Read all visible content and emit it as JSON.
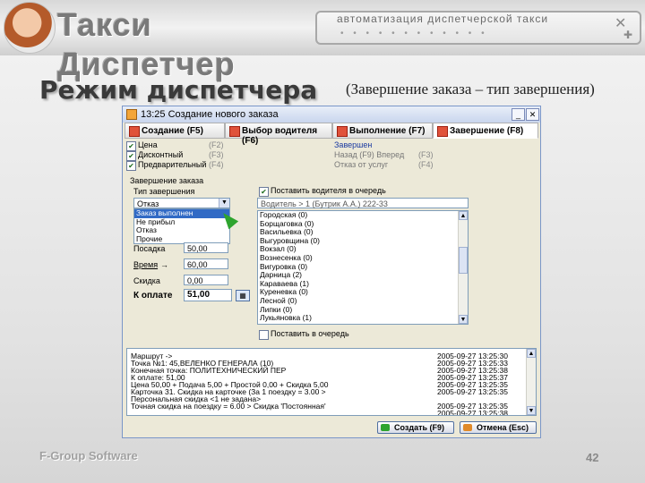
{
  "header": {
    "brand": "Такси Диспетчер",
    "tagline": "автоматизация диспетчерской такси",
    "dots": "• • • • • • • • • • • •"
  },
  "slide": {
    "title": "Режим диспетчера",
    "subtitle": "(Завершение заказа – тип завершения)",
    "footer": "F-Group Software",
    "page": "42"
  },
  "window": {
    "title": "13:25 Создание нового заказа",
    "tabs": [
      "Создание (F5)",
      "Выбор водителя (F6)",
      "Выполнение (F7)",
      "Завершение (F8)"
    ],
    "type_options": [
      {
        "label": "Цена",
        "hot": "(F2)",
        "checked": true
      },
      {
        "label": "Дисконтный",
        "hot": "(F3)",
        "checked": true
      },
      {
        "label": "Предварительный",
        "hot": "(F4)",
        "checked": true
      }
    ],
    "status_items": [
      {
        "label": "Завершен",
        "hot": ""
      },
      {
        "label": "Назад (F9) Вперед",
        "hot": "(F3)"
      },
      {
        "label": "Отказ от услуг",
        "hot": "(F4)"
      }
    ],
    "completion_group": "Завершение заказа",
    "completion_type_label": "Тип завершения",
    "completion_select": "Отказ",
    "dropdown_options": [
      "Заказ выполнен",
      "Не прибыл",
      "Отказ",
      "Прочие"
    ],
    "notify_label": "Поставить водителя в очередь",
    "driver_field": "Водитель > 1 (Бутрик А.А.) 222-33",
    "rows": [
      {
        "label": "Посадка",
        "value": "50,00"
      },
      {
        "label": "Время",
        "value": "60,00"
      },
      {
        "label": "Скидка",
        "value": "0,00"
      }
    ],
    "total_label": "К оплате",
    "total_value": "51,00",
    "districts": [
      "Городская (0)",
      "Борщаговка (0)",
      "Васильевка (0)",
      "Выгуровщина (0)",
      "Вокзал (0)",
      "Вознесенка (0)",
      "Вигуровка (0)",
      "Дарница (2)",
      "Караваева (1)",
      "Куреневка (0)",
      "Лесной (0)",
      "Липки (0)",
      "Лукьяновка (1)",
      "Нивки (0)"
    ],
    "district_more": "...",
    "bottom_check": "Поставить в очередь",
    "log": [
      {
        "text": "Маршрут ->",
        "time": "2005-09-27 13:25:30"
      },
      {
        "text": "Точка №1: 45,ВЕЛЕНКО ГЕНЕРАЛА (10)",
        "time": "2005-09-27 13:25:33"
      },
      {
        "text": "Конечная точка: ПОЛИТЕХНИЧЕСКИЙ ПЕР",
        "time": "2005-09-27 13:25:38"
      },
      {
        "text": "К оплате: 51,00",
        "time": "2005-09-27 13:25:37"
      },
      {
        "text": "Цена 50,00 + Подача 5,00 + Простой 0,00 + Скидка 5,00",
        "time": "2005-09-27 13:25:35"
      },
      {
        "text": "Карточка 31. Скидка на карточке (За 1 поездку = 3.00 >",
        "time": "2005-09-27 13:25:35"
      },
      {
        "text": "Персональная скидка <1 не задана>",
        "time": ""
      },
      {
        "text": "Точная скидка на поездку = 6.00 > Скидка 'Постоянная'",
        "time": "2005-09-27 13:25:35"
      },
      {
        "text": "",
        "time": "2005-09-27 13:25:38"
      }
    ],
    "btn_ok": "Создать (F9)",
    "btn_cancel": "Отмена (Esc)"
  },
  "colors": {
    "accent": "#e0523a",
    "ok": "#2ea42e",
    "cancel": "#e08a2a"
  }
}
